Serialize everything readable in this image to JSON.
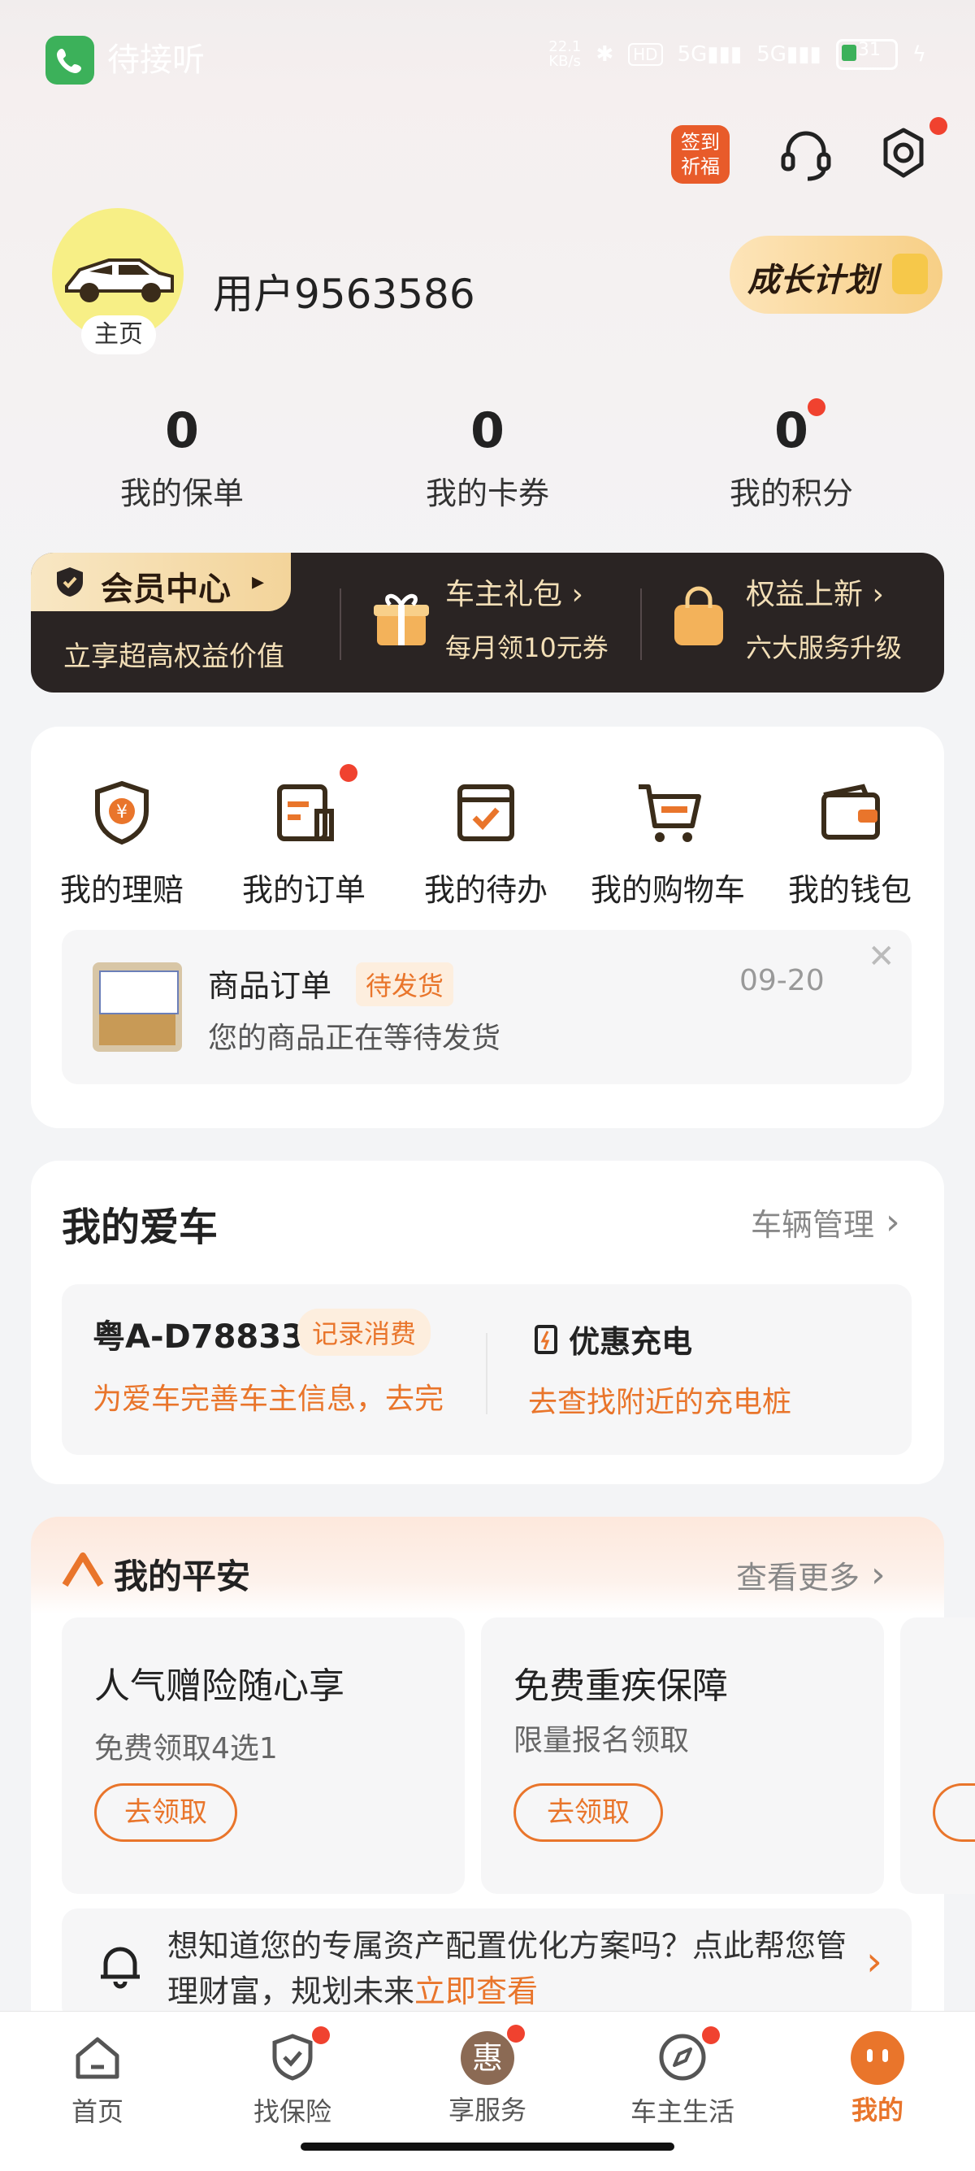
{
  "status_bar": {
    "call_text": "待接听",
    "net_speed": "22.1\nKB/s",
    "battery": "31"
  },
  "top_actions": {
    "sign_in": "签到\n祈福"
  },
  "profile": {
    "home_tag": "主页",
    "username": "用户9563586",
    "growth_plan": "成长计划"
  },
  "stats": [
    {
      "value": "0",
      "label": "我的保单"
    },
    {
      "value": "0",
      "label": "我的卡券"
    },
    {
      "value": "0",
      "label": "我的积分"
    }
  ],
  "member": {
    "title": "会员中心",
    "subtitle": "立享超高权益价值",
    "gift_title": "车主礼包 ›",
    "gift_sub": "每月领10元券",
    "rights_title": "权益上新 ›",
    "rights_sub": "六大服务升级"
  },
  "quick_links": [
    {
      "label": "我的理赔",
      "icon": "shield-yen-icon"
    },
    {
      "label": "我的订单",
      "icon": "order-icon"
    },
    {
      "label": "我的待办",
      "icon": "todo-icon"
    },
    {
      "label": "我的购物车",
      "icon": "cart-icon"
    },
    {
      "label": "我的钱包",
      "icon": "wallet-icon"
    }
  ],
  "order_notice": {
    "title": "商品订单",
    "badge": "待发货",
    "date": "09-20",
    "desc": "您的商品正在等待发货"
  },
  "car": {
    "section_title": "我的爱车",
    "manage": "车辆管理",
    "plate": "粤A-D78833",
    "record_badge": "记录消费",
    "prompt": "为爱车完善车主信息，去完",
    "charge_title": "优惠充电",
    "charge_sub": "去查找附近的充电桩"
  },
  "pingan": {
    "title": "我的平安",
    "more": "查看更多",
    "cards": [
      {
        "title": "人气赠险随心享",
        "sub": "免费领取4选1",
        "button": "去领取"
      },
      {
        "title": "免费重疾保障",
        "sub": "限量报名领取",
        "button": "去领取"
      }
    ],
    "advice_text": "想知道您的专属资产配置优化方案吗？点此帮您管理财富，规划未来",
    "advice_link": "立即查看"
  },
  "tabbar": [
    {
      "label": "首页"
    },
    {
      "label": "找保险"
    },
    {
      "label": "享服务",
      "icon_text": "惠"
    },
    {
      "label": "车主生活"
    },
    {
      "label": "我的"
    }
  ],
  "colors": {
    "accent": "#e9752b",
    "red_dot": "#f0422f",
    "dark": "#2a2423",
    "gold": "#f3dfb7"
  }
}
